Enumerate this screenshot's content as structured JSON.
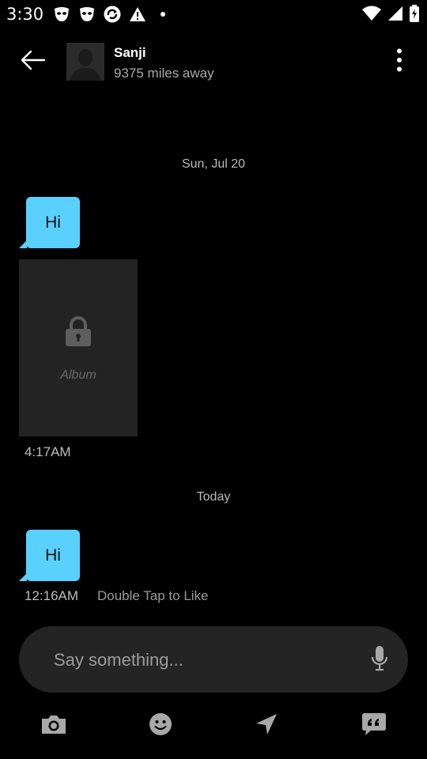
{
  "status_bar": {
    "time": "3:30"
  },
  "header": {
    "name": "Sanji",
    "distance": "9375 miles away"
  },
  "messages": {
    "date_1": "Sun, Jul 20",
    "bubble_1": "Hi",
    "album_label": "Album",
    "time_1": "4:17AM",
    "date_2": "Today",
    "bubble_2": "Hi",
    "time_2": "12:16AM",
    "like_hint": "Double Tap to Like"
  },
  "composer": {
    "placeholder": "Say something..."
  },
  "colors": {
    "bubble": "#5ad0ff",
    "background": "#000000",
    "input": "#242424",
    "icon": "#a8a8a8"
  },
  "icons": {
    "back": "arrow-left-icon",
    "more": "more-vertical-icon",
    "lock": "lock-icon",
    "mic": "microphone-icon",
    "camera": "camera-icon",
    "emoji": "smiley-icon",
    "location": "send-location-icon",
    "phrases": "saved-phrases-icon"
  }
}
